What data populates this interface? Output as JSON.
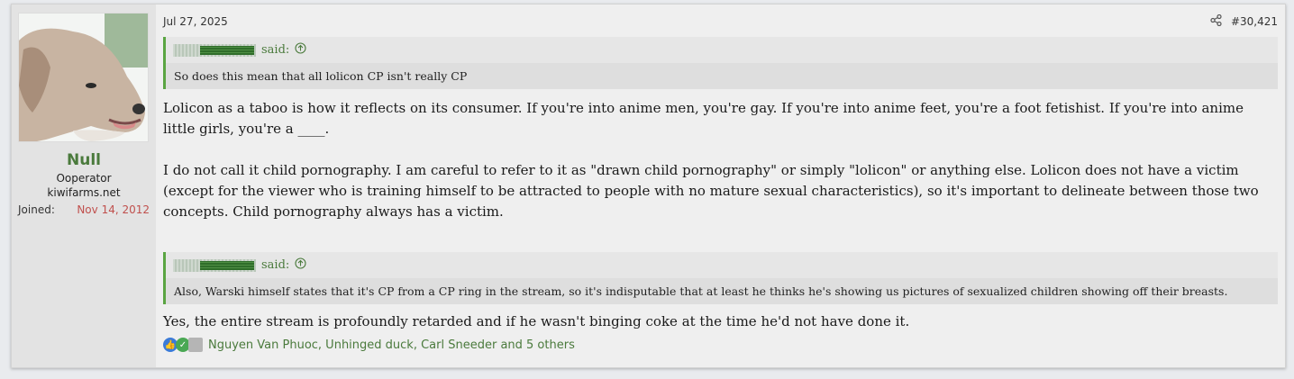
{
  "user": {
    "name": "Null",
    "title": "Ooperator",
    "site": "kiwifarms.net",
    "joined_label": "Joined:",
    "joined_date": "Nov 14, 2012"
  },
  "post": {
    "date": "Jul 27, 2025",
    "number": "#30,421",
    "quote1": {
      "said": "said:",
      "text": "So does this mean that all lolicon CP isn't really CP"
    },
    "paragraph1": "Lolicon as a taboo is how it reflects on its consumer. If you're into anime men, you're gay. If you're into anime feet, you're a foot fetishist. If you're into anime little girls, you're a ____.",
    "paragraph2": "I do not call it child pornography. I am careful to refer to it as \"drawn child pornography\" or simply \"lolicon\" or anything else. Lolicon does not have a victim (except for the viewer who is training himself to be attracted to people with no mature sexual characteristics), so it's important to delineate between those two concepts. Child pornography always has a victim.",
    "quote2": {
      "said": "said:",
      "text": "Also, Warski himself states that it's CP from a CP ring in the stream, so it's indisputable that at least he thinks he's showing us pictures of sexualized children showing off their breasts."
    },
    "paragraph3": "Yes, the entire stream is profoundly retarded and if he wasn't binging coke at the time he'd not have done it.",
    "reactions": "Nguyen Van Phuoc, Unhinged duck, Carl Sneeder and 5 others"
  },
  "icons": {
    "share": "share-icon",
    "quote_jump": "arrow-up-circle-icon",
    "reaction_like": "thumbs-up-icon",
    "reaction_agree": "check-icon"
  },
  "colors": {
    "accent_green": "#4a7a3c",
    "quote_border": "#5aa542",
    "joined_date": "#c0504d",
    "like_blue": "#3b7bd8"
  }
}
